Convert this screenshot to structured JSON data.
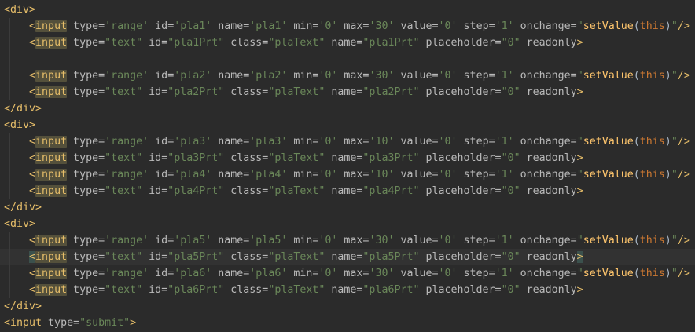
{
  "editor": {
    "colors": {
      "background": "#2b2b2b",
      "tag": "#e8bf6a",
      "attribute": "#bababa",
      "string": "#6a8759",
      "function": "#ffc66d",
      "keyword": "#cc7832"
    },
    "lines": [
      {
        "indent": false,
        "tokens": [
          {
            "t": "tag",
            "v": "<div>"
          }
        ]
      },
      {
        "indent": true,
        "tokens": [
          {
            "t": "tag",
            "v": "<"
          },
          {
            "t": "hl",
            "v": "input"
          },
          {
            "t": "attr",
            "v": " type="
          },
          {
            "t": "str",
            "v": "'range'"
          },
          {
            "t": "attr",
            "v": " id="
          },
          {
            "t": "str",
            "v": "'pla1'"
          },
          {
            "t": "attr",
            "v": " name="
          },
          {
            "t": "str",
            "v": "'pla1'"
          },
          {
            "t": "attr",
            "v": " min="
          },
          {
            "t": "str",
            "v": "'0'"
          },
          {
            "t": "attr",
            "v": " max="
          },
          {
            "t": "str",
            "v": "'30'"
          },
          {
            "t": "attr",
            "v": " value="
          },
          {
            "t": "str",
            "v": "'0'"
          },
          {
            "t": "attr",
            "v": " step="
          },
          {
            "t": "str",
            "v": "'1'"
          },
          {
            "t": "attr",
            "v": " onchange="
          },
          {
            "t": "str",
            "v": "\""
          },
          {
            "t": "fn",
            "v": "setValue"
          },
          {
            "t": "plain",
            "v": "("
          },
          {
            "t": "kw",
            "v": "this"
          },
          {
            "t": "plain",
            "v": ")"
          },
          {
            "t": "str",
            "v": "\""
          },
          {
            "t": "tag",
            "v": "/>"
          }
        ]
      },
      {
        "indent": true,
        "tokens": [
          {
            "t": "tag",
            "v": "<"
          },
          {
            "t": "hl",
            "v": "input"
          },
          {
            "t": "attr",
            "v": " type="
          },
          {
            "t": "str",
            "v": "\"text\""
          },
          {
            "t": "attr",
            "v": " id="
          },
          {
            "t": "str",
            "v": "\"pla1Prt\""
          },
          {
            "t": "attr",
            "v": " class="
          },
          {
            "t": "str",
            "v": "\"plaText\""
          },
          {
            "t": "attr",
            "v": " name="
          },
          {
            "t": "str",
            "v": "\"pla1Prt\""
          },
          {
            "t": "attr",
            "v": " placeholder="
          },
          {
            "t": "str",
            "v": "\"0\""
          },
          {
            "t": "attr",
            "v": " readonly"
          },
          {
            "t": "tag",
            "v": ">"
          }
        ]
      },
      {
        "indent": true,
        "tokens": []
      },
      {
        "indent": true,
        "tokens": [
          {
            "t": "tag",
            "v": "<"
          },
          {
            "t": "hl",
            "v": "input"
          },
          {
            "t": "attr",
            "v": " type="
          },
          {
            "t": "str",
            "v": "'range'"
          },
          {
            "t": "attr",
            "v": " id="
          },
          {
            "t": "str",
            "v": "'pla2'"
          },
          {
            "t": "attr",
            "v": " name="
          },
          {
            "t": "str",
            "v": "'pla2'"
          },
          {
            "t": "attr",
            "v": " min="
          },
          {
            "t": "str",
            "v": "'0'"
          },
          {
            "t": "attr",
            "v": " max="
          },
          {
            "t": "str",
            "v": "'30'"
          },
          {
            "t": "attr",
            "v": " value="
          },
          {
            "t": "str",
            "v": "'0'"
          },
          {
            "t": "attr",
            "v": " step="
          },
          {
            "t": "str",
            "v": "'1'"
          },
          {
            "t": "attr",
            "v": " onchange="
          },
          {
            "t": "str",
            "v": "\""
          },
          {
            "t": "fn",
            "v": "setValue"
          },
          {
            "t": "plain",
            "v": "("
          },
          {
            "t": "kw",
            "v": "this"
          },
          {
            "t": "plain",
            "v": ")"
          },
          {
            "t": "str",
            "v": "\""
          },
          {
            "t": "tag",
            "v": "/>"
          }
        ]
      },
      {
        "indent": true,
        "tokens": [
          {
            "t": "tag",
            "v": "<"
          },
          {
            "t": "hl",
            "v": "input"
          },
          {
            "t": "attr",
            "v": " type="
          },
          {
            "t": "str",
            "v": "\"text\""
          },
          {
            "t": "attr",
            "v": " id="
          },
          {
            "t": "str",
            "v": "\"pla2Prt\""
          },
          {
            "t": "attr",
            "v": " class="
          },
          {
            "t": "str",
            "v": "\"plaText\""
          },
          {
            "t": "attr",
            "v": " name="
          },
          {
            "t": "str",
            "v": "\"pla2Prt\""
          },
          {
            "t": "attr",
            "v": " placeholder="
          },
          {
            "t": "str",
            "v": "\"0\""
          },
          {
            "t": "attr",
            "v": " readonly"
          },
          {
            "t": "tag",
            "v": ">"
          }
        ]
      },
      {
        "indent": false,
        "tokens": [
          {
            "t": "tag",
            "v": "</div>"
          }
        ]
      },
      {
        "indent": false,
        "tokens": [
          {
            "t": "tag",
            "v": "<div>"
          }
        ]
      },
      {
        "indent": true,
        "tokens": [
          {
            "t": "tag",
            "v": "<"
          },
          {
            "t": "hl",
            "v": "input"
          },
          {
            "t": "attr",
            "v": " type="
          },
          {
            "t": "str",
            "v": "'range'"
          },
          {
            "t": "attr",
            "v": " id="
          },
          {
            "t": "str",
            "v": "'pla3'"
          },
          {
            "t": "attr",
            "v": " name="
          },
          {
            "t": "str",
            "v": "'pla3'"
          },
          {
            "t": "attr",
            "v": " min="
          },
          {
            "t": "str",
            "v": "'0'"
          },
          {
            "t": "attr",
            "v": " max="
          },
          {
            "t": "str",
            "v": "'10'"
          },
          {
            "t": "attr",
            "v": " value="
          },
          {
            "t": "str",
            "v": "'0'"
          },
          {
            "t": "attr",
            "v": " step="
          },
          {
            "t": "str",
            "v": "'1'"
          },
          {
            "t": "attr",
            "v": " onchange="
          },
          {
            "t": "str",
            "v": "\""
          },
          {
            "t": "fn",
            "v": "setValue"
          },
          {
            "t": "plain",
            "v": "("
          },
          {
            "t": "kw",
            "v": "this"
          },
          {
            "t": "plain",
            "v": ")"
          },
          {
            "t": "str",
            "v": "\""
          },
          {
            "t": "tag",
            "v": "/>"
          }
        ]
      },
      {
        "indent": true,
        "tokens": [
          {
            "t": "tag",
            "v": "<"
          },
          {
            "t": "hl",
            "v": "input"
          },
          {
            "t": "attr",
            "v": " type="
          },
          {
            "t": "str",
            "v": "\"text\""
          },
          {
            "t": "attr",
            "v": " id="
          },
          {
            "t": "str",
            "v": "\"pla3Prt\""
          },
          {
            "t": "attr",
            "v": " class="
          },
          {
            "t": "str",
            "v": "\"plaText\""
          },
          {
            "t": "attr",
            "v": " name="
          },
          {
            "t": "str",
            "v": "\"pla3Prt\""
          },
          {
            "t": "attr",
            "v": " placeholder="
          },
          {
            "t": "str",
            "v": "\"0\""
          },
          {
            "t": "attr",
            "v": " readonly"
          },
          {
            "t": "tag",
            "v": ">"
          }
        ]
      },
      {
        "indent": true,
        "tokens": [
          {
            "t": "tag",
            "v": "<"
          },
          {
            "t": "hl",
            "v": "input"
          },
          {
            "t": "attr",
            "v": " type="
          },
          {
            "t": "str",
            "v": "'range'"
          },
          {
            "t": "attr",
            "v": " id="
          },
          {
            "t": "str",
            "v": "'pla4'"
          },
          {
            "t": "attr",
            "v": " name="
          },
          {
            "t": "str",
            "v": "'pla4'"
          },
          {
            "t": "attr",
            "v": " min="
          },
          {
            "t": "str",
            "v": "'0'"
          },
          {
            "t": "attr",
            "v": " max="
          },
          {
            "t": "str",
            "v": "'10'"
          },
          {
            "t": "attr",
            "v": " value="
          },
          {
            "t": "str",
            "v": "'0'"
          },
          {
            "t": "attr",
            "v": " step="
          },
          {
            "t": "str",
            "v": "'1'"
          },
          {
            "t": "attr",
            "v": " onchange="
          },
          {
            "t": "str",
            "v": "\""
          },
          {
            "t": "fn",
            "v": "setValue"
          },
          {
            "t": "plain",
            "v": "("
          },
          {
            "t": "kw",
            "v": "this"
          },
          {
            "t": "plain",
            "v": ")"
          },
          {
            "t": "str",
            "v": "\""
          },
          {
            "t": "tag",
            "v": "/>"
          }
        ]
      },
      {
        "indent": true,
        "tokens": [
          {
            "t": "tag",
            "v": "<"
          },
          {
            "t": "hl",
            "v": "input"
          },
          {
            "t": "attr",
            "v": " type="
          },
          {
            "t": "str",
            "v": "\"text\""
          },
          {
            "t": "attr",
            "v": " id="
          },
          {
            "t": "str",
            "v": "\"pla4Prt\""
          },
          {
            "t": "attr",
            "v": " class="
          },
          {
            "t": "str",
            "v": "\"plaText\""
          },
          {
            "t": "attr",
            "v": " name="
          },
          {
            "t": "str",
            "v": "\"pla4Prt\""
          },
          {
            "t": "attr",
            "v": " placeholder="
          },
          {
            "t": "str",
            "v": "\"0\""
          },
          {
            "t": "attr",
            "v": " readonly"
          },
          {
            "t": "tag",
            "v": ">"
          }
        ]
      },
      {
        "indent": false,
        "tokens": [
          {
            "t": "tag",
            "v": "</div>"
          }
        ]
      },
      {
        "indent": false,
        "tokens": [
          {
            "t": "tag",
            "v": "<div>"
          }
        ]
      },
      {
        "indent": true,
        "tokens": [
          {
            "t": "tag",
            "v": "<"
          },
          {
            "t": "hl",
            "v": "input"
          },
          {
            "t": "attr",
            "v": " type="
          },
          {
            "t": "str",
            "v": "'range'"
          },
          {
            "t": "attr",
            "v": " id="
          },
          {
            "t": "str",
            "v": "'pla5'"
          },
          {
            "t": "attr",
            "v": " name="
          },
          {
            "t": "str",
            "v": "'pla5'"
          },
          {
            "t": "attr",
            "v": " min="
          },
          {
            "t": "str",
            "v": "'0'"
          },
          {
            "t": "attr",
            "v": " max="
          },
          {
            "t": "str",
            "v": "'30'"
          },
          {
            "t": "attr",
            "v": " value="
          },
          {
            "t": "str",
            "v": "'0'"
          },
          {
            "t": "attr",
            "v": " step="
          },
          {
            "t": "str",
            "v": "'1'"
          },
          {
            "t": "attr",
            "v": " onchange="
          },
          {
            "t": "str",
            "v": "\""
          },
          {
            "t": "fn",
            "v": "setValue"
          },
          {
            "t": "plain",
            "v": "("
          },
          {
            "t": "kw",
            "v": "this"
          },
          {
            "t": "plain",
            "v": ")"
          },
          {
            "t": "str",
            "v": "\""
          },
          {
            "t": "tag",
            "v": "/>"
          }
        ]
      },
      {
        "indent": true,
        "current": true,
        "tokens": [
          {
            "t": "bracket",
            "v": "<"
          },
          {
            "t": "hl",
            "v": "input"
          },
          {
            "t": "attr",
            "v": " type="
          },
          {
            "t": "str",
            "v": "\"text\""
          },
          {
            "t": "attr",
            "v": " id="
          },
          {
            "t": "str",
            "v": "\"pla5Prt\""
          },
          {
            "t": "attr",
            "v": " class="
          },
          {
            "t": "str",
            "v": "\"plaText\""
          },
          {
            "t": "attr",
            "v": " name="
          },
          {
            "t": "str",
            "v": "\"pla5Prt\""
          },
          {
            "t": "attr",
            "v": " placeholder="
          },
          {
            "t": "str",
            "v": "\"0\""
          },
          {
            "t": "attr",
            "v": " readonly"
          },
          {
            "t": "bracket",
            "v": ">"
          }
        ]
      },
      {
        "indent": true,
        "tokens": [
          {
            "t": "tag",
            "v": "<"
          },
          {
            "t": "hl",
            "v": "input"
          },
          {
            "t": "attr",
            "v": " type="
          },
          {
            "t": "str",
            "v": "'range'"
          },
          {
            "t": "attr",
            "v": " id="
          },
          {
            "t": "str",
            "v": "'pla6'"
          },
          {
            "t": "attr",
            "v": " name="
          },
          {
            "t": "str",
            "v": "'pla6'"
          },
          {
            "t": "attr",
            "v": " min="
          },
          {
            "t": "str",
            "v": "'0'"
          },
          {
            "t": "attr",
            "v": " max="
          },
          {
            "t": "str",
            "v": "'30'"
          },
          {
            "t": "attr",
            "v": " value="
          },
          {
            "t": "str",
            "v": "'0'"
          },
          {
            "t": "attr",
            "v": " step="
          },
          {
            "t": "str",
            "v": "'1'"
          },
          {
            "t": "attr",
            "v": " onchange="
          },
          {
            "t": "str",
            "v": "\""
          },
          {
            "t": "fn",
            "v": "setValue"
          },
          {
            "t": "plain",
            "v": "("
          },
          {
            "t": "kw",
            "v": "this"
          },
          {
            "t": "plain",
            "v": ")"
          },
          {
            "t": "str",
            "v": "\""
          },
          {
            "t": "tag",
            "v": "/>"
          }
        ]
      },
      {
        "indent": true,
        "tokens": [
          {
            "t": "tag",
            "v": "<"
          },
          {
            "t": "hl",
            "v": "input"
          },
          {
            "t": "attr",
            "v": " type="
          },
          {
            "t": "str",
            "v": "\"text\""
          },
          {
            "t": "attr",
            "v": " id="
          },
          {
            "t": "str",
            "v": "\"pla6Prt\""
          },
          {
            "t": "attr",
            "v": " class="
          },
          {
            "t": "str",
            "v": "\"plaText\""
          },
          {
            "t": "attr",
            "v": " name="
          },
          {
            "t": "str",
            "v": "\"pla6Prt\""
          },
          {
            "t": "attr",
            "v": " placeholder="
          },
          {
            "t": "str",
            "v": "\"0\""
          },
          {
            "t": "attr",
            "v": " readonly"
          },
          {
            "t": "tag",
            "v": ">"
          }
        ]
      },
      {
        "indent": false,
        "tokens": [
          {
            "t": "tag",
            "v": "</div>"
          }
        ]
      },
      {
        "indent": false,
        "tokens": [
          {
            "t": "tag",
            "v": "<input"
          },
          {
            "t": "attr",
            "v": " type="
          },
          {
            "t": "str",
            "v": "\"submit\""
          },
          {
            "t": "tag",
            "v": ">"
          }
        ]
      }
    ]
  }
}
